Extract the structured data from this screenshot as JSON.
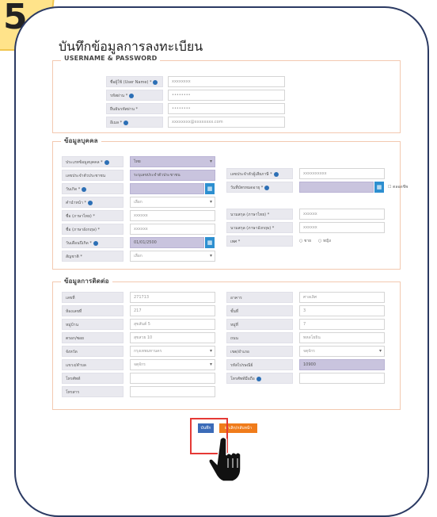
{
  "step_number": "5",
  "title": "บันทึกข้อมูลการลงทะเบียน",
  "sections": {
    "credentials": {
      "legend": "USERNAME & PASSWORD",
      "rows": [
        {
          "label": "ชื่อผู้ใช้ (User Name) *",
          "value": "xxxxxxxx",
          "info": true
        },
        {
          "label": "รหัสผ่าน *",
          "value": "••••••••",
          "info": true
        },
        {
          "label": "ยืนยันรหัสผ่าน *",
          "value": "••••••••",
          "info": false
        },
        {
          "label": "อีเมล *",
          "value": "xxxxxxxx@xxxxxxxx.com",
          "info": true
        }
      ]
    },
    "personal": {
      "legend": "ข้อมูลบุคคล",
      "left": [
        {
          "label": "ประเภทข้อมูลบุคคล *",
          "value": "ไทย",
          "info": true,
          "style": "purple-sel"
        },
        {
          "label": "เลขประจำตัวประชาชน",
          "value": "ระบุเลขประจำตัวประชาชน",
          "info": false,
          "style": "purple"
        },
        {
          "label": "วันเกิด *",
          "value": "",
          "info": true,
          "style": "purple-btn"
        },
        {
          "label": "คำนำหน้า *",
          "value": "เลือก",
          "info": true,
          "style": "sel"
        },
        {
          "label": "ชื่อ (ภาษาไทย) *",
          "value": "xxxxxx",
          "info": false,
          "style": "plain"
        },
        {
          "label": "ชื่อ (ภาษาอังกฤษ) *",
          "value": "xxxxxx",
          "info": false,
          "style": "plain"
        },
        {
          "label": "วันเดือนปีเกิด *",
          "value": "01/01/2500",
          "info": true,
          "style": "purple-btn"
        },
        {
          "label": "สัญชาติ *",
          "value": "เลือก",
          "info": false,
          "style": "sel"
        }
      ],
      "right": [
        {
          "label": "เลขประจำตัวผู้เสียภาษี *",
          "value": "xxxxxxxxxx",
          "info": true,
          "style": "plain"
        },
        {
          "label": "วันที่บัตรหมดอายุ *",
          "value": "",
          "info": true,
          "style": "purple-btn",
          "extra": "ตลอดชีพ"
        },
        {
          "label": "นามสกุล (ภาษาไทย) *",
          "value": "xxxxxx",
          "info": false,
          "style": "plain"
        },
        {
          "label": "นามสกุล (ภาษาอังกฤษ) *",
          "value": "xxxxxx",
          "info": false,
          "style": "plain"
        },
        {
          "label": "เพศ *",
          "value": "",
          "info": false,
          "style": "radio",
          "radio1": "ชาย",
          "radio2": "หญิง"
        }
      ]
    },
    "contact": {
      "legend": "ข้อมูลการติดต่อ",
      "left": [
        {
          "label": "เลขที่",
          "value": "271713",
          "style": "plain"
        },
        {
          "label": "ห้องเลขที่",
          "value": "217",
          "style": "plain"
        },
        {
          "label": "หมู่บ้าน",
          "value": "สุขสันต์ 5",
          "style": "plain"
        },
        {
          "label": "ตรอก/ซอย",
          "value": "สุขสวย 10",
          "style": "plain"
        },
        {
          "label": "จังหวัด",
          "value": "กรุงเทพมหานคร",
          "style": "sel"
        },
        {
          "label": "แขวง/ตำบล",
          "value": "จตุจักร",
          "style": "sel"
        },
        {
          "label": "โทรศัพท์",
          "value": "",
          "style": "plain"
        },
        {
          "label": "โทรสาร",
          "value": "",
          "style": "plain"
        }
      ],
      "right": [
        {
          "label": "อาคาร",
          "value": "ศาลเลิศ",
          "style": "plain"
        },
        {
          "label": "ชั้นที่",
          "value": "3",
          "style": "plain"
        },
        {
          "label": "หมู่ที่",
          "value": "7",
          "style": "plain"
        },
        {
          "label": "ถนน",
          "value": "พหลโยธิน",
          "style": "plain"
        },
        {
          "label": "เขต/อำเภอ",
          "value": "จตุจักร",
          "style": "sel"
        },
        {
          "label": "รหัสไปรษณีย์",
          "value": "10900",
          "style": "purple"
        },
        {
          "label": "โทรศัพท์มือถือ",
          "value": "",
          "style": "plain",
          "info": true
        }
      ]
    }
  },
  "buttons": {
    "save": "บันทึก",
    "cancel": "ยกเลิก/กลับหน้า"
  },
  "colors": {
    "frame": "#2b3a63",
    "step_tag": "#ffe38a",
    "section_border": "#f3c9b0",
    "save_button": "#3b6bb8",
    "cancel_button": "#f07c1b",
    "highlight": "#e53935"
  }
}
